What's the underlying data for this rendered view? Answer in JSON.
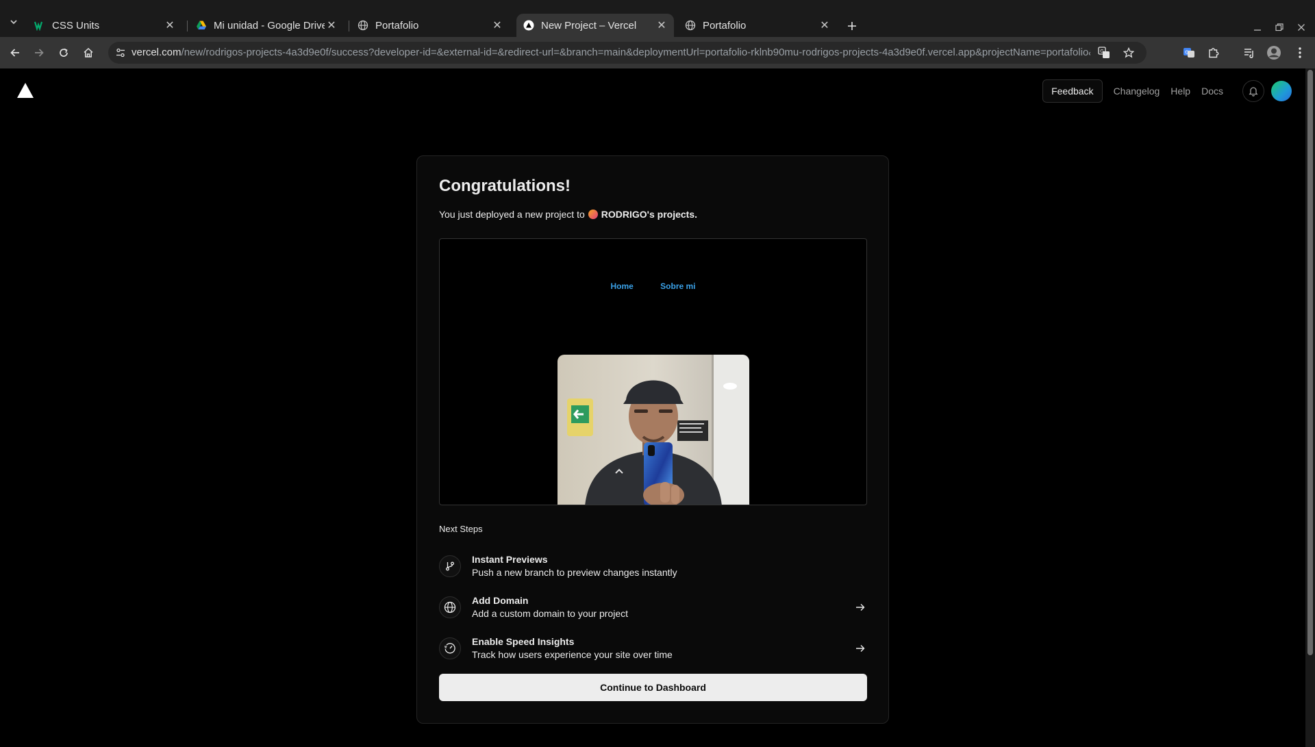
{
  "browser": {
    "tabs": [
      {
        "title": "CSS Units",
        "favicon": "w3schools-icon"
      },
      {
        "title": "Mi unidad - Google Drive",
        "favicon": "google-drive-icon"
      },
      {
        "title": "Portafolio",
        "favicon": "globe-icon"
      },
      {
        "title": "New Project – Vercel",
        "favicon": "vercel-icon",
        "active": true
      },
      {
        "title": "Portafolio",
        "favicon": "globe-icon"
      }
    ],
    "url_host": "vercel.com",
    "url_path": "/new/rodrigos-projects-4a3d9e0f/success?developer-id=&external-id=&redirect-url=&branch=main&deploymentUrl=portafolio-rklnb90mu-rodrigos-projects-4a3d9e0f.vercel.app&projectName=portafolio&s=https%3A%..."
  },
  "header": {
    "feedback": "Feedback",
    "links": [
      "Changelog",
      "Help",
      "Docs"
    ]
  },
  "card": {
    "title": "Congratulations!",
    "subtitle_prefix": "You just deployed a new project to",
    "team": "RODRIGO's projects.",
    "preview": {
      "nav": [
        "Home",
        "Sobre mi"
      ]
    },
    "next_steps_title": "Next Steps",
    "steps": [
      {
        "title": "Instant Previews",
        "desc": "Push a new branch to preview changes instantly",
        "icon": "git-branch-icon",
        "arrow": false
      },
      {
        "title": "Add Domain",
        "desc": "Add a custom domain to your project",
        "icon": "globe-icon",
        "arrow": true
      },
      {
        "title": "Enable Speed Insights",
        "desc": "Track how users experience your site over time",
        "icon": "speed-gauge-icon",
        "arrow": true
      }
    ],
    "continue": "Continue to Dashboard"
  },
  "colors": {
    "background": "#000000",
    "card": "#0a0a0a",
    "preview_nav_link": "#3aa0e6",
    "primary_button": "#ededed"
  }
}
